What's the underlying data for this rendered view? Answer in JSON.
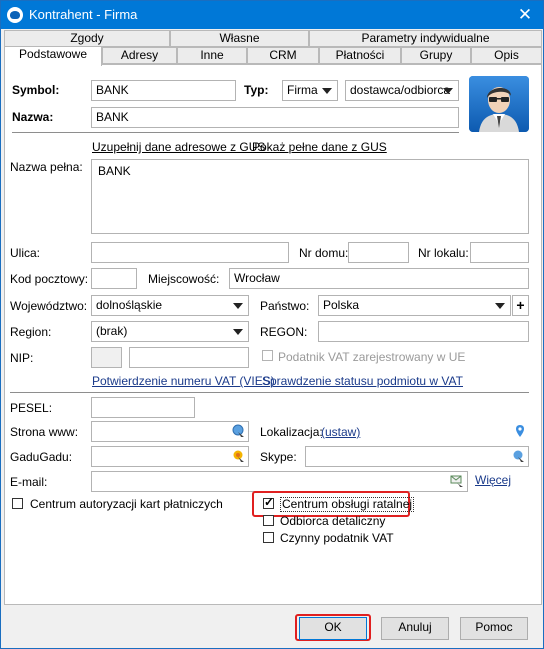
{
  "window": {
    "title": "Kontrahent - Firma"
  },
  "tabs_row1": [
    "Zgody",
    "Własne",
    "Parametry indywidualne"
  ],
  "tabs_row2": [
    "Podstawowe",
    "Adresy",
    "Inne",
    "CRM",
    "Płatności",
    "Grupy",
    "Opis"
  ],
  "form": {
    "symbol_label": "Symbol:",
    "symbol_value": "BANK",
    "typ_label": "Typ:",
    "typ_value": "Firma",
    "typ2_value": "dostawca/odbiorca",
    "nazwa_label": "Nazwa:",
    "nazwa_value": "BANK",
    "gus_link1": "Uzupełnij dane adresowe z GUS",
    "gus_link2": "Pokaż pełne dane z GUS",
    "nazwa_pelna_label": "Nazwa pełna:",
    "nazwa_pelna_value": "BANK",
    "ulica_label": "Ulica:",
    "nrdomu_label": "Nr domu:",
    "nrlokalu_label": "Nr lokalu:",
    "kod_label": "Kod pocztowy:",
    "miejscowosc_label": "Miejscowość:",
    "miejscowosc_value": "Wrocław",
    "woj_label": "Województwo:",
    "woj_value": "dolnośląskie",
    "panstwo_label": "Państwo:",
    "panstwo_value": "Polska",
    "plus_label": "+",
    "region_label": "Region:",
    "region_value": "(brak)",
    "regon_label": "REGON:",
    "nip_label": "NIP:",
    "vat_ue_label": "Podatnik VAT zarejestrowany w UE",
    "vies_link": "Potwierdzenie numeru VAT (VIES)",
    "vat_status_link": "Sprawdzenie statusu podmiotu w VAT",
    "pesel_label": "PESEL:",
    "www_label": "Strona www:",
    "lokalizacja_label": "Lokalizacja:",
    "lokalizacja_link": "(ustaw)",
    "gadu_label": "GaduGadu:",
    "skype_label": "Skype:",
    "email_label": "E-mail:",
    "wiecej_link": "Więcej",
    "cb_karty": "Centrum autoryzacji kart płatniczych",
    "cb_ratalne": "Centrum obsługi ratalnej",
    "cb_detaliczny": "Odbiorca detaliczny",
    "cb_czynny": "Czynny podatnik VAT"
  },
  "buttons": {
    "ok": "OK",
    "anuluj": "Anuluj",
    "pomoc": "Pomoc"
  }
}
